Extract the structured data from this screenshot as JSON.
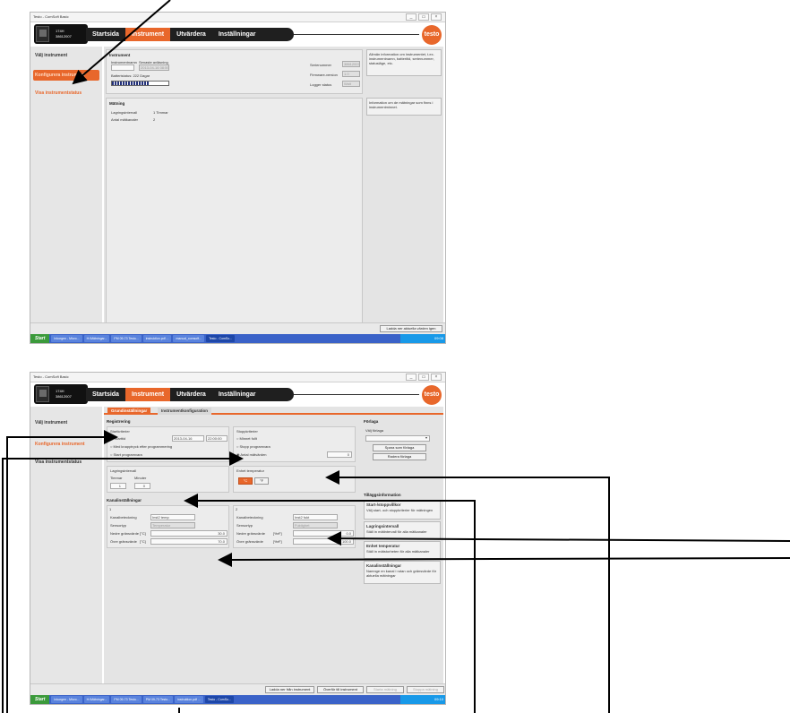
{
  "app_title": "Testo - ComSoft Basic",
  "window_controls": [
    "_",
    "▭",
    "×"
  ],
  "device": {
    "model": "174H",
    "serial": "38612007"
  },
  "nav_tabs": [
    "Startsida",
    "Instrument",
    "Utvärdera",
    "Inställningar"
  ],
  "logo_text": "testo",
  "shot1": {
    "sidebar": [
      "Välj instrument",
      "Konfigurera instrument",
      "Visa instrumentstatus"
    ],
    "instrument_panel": {
      "title": "Instrument",
      "name_label": "Instrumentnamn",
      "last_programming_label": "Senaste avläsning",
      "name_value": "",
      "last_programming_value": "2013-04-16 08:59:05",
      "battery_label": "Batteristatus: 222 Dagar",
      "battery_level_percent": 65,
      "serial_label": "Serienummer",
      "serial_value": "38612007",
      "firmware_label": "Firmware-version",
      "firmware_value": "1.0",
      "logger_label": "Logger status",
      "logger_value": "Wait"
    },
    "measurement_panel": {
      "title": "Mätning",
      "interval_label": "Lagringsintervall",
      "interval_value": "1 Timmar",
      "channels_label": "Antal mätkanaler",
      "channels_value": "2"
    },
    "tip1": "Allmän information om instrumentet, t.ex. instrumentnamn, batteritid, serienummer, statusläge, etc.",
    "tip2": "Information om de mätningar som finns i instrumentminnet.",
    "reload_button": "Ladda ner aktuella värden igen"
  },
  "shot2": {
    "sidebar": [
      "Välj instrument",
      "Konfigurera instrument",
      "Visa instrumentstatus"
    ],
    "subtabs": [
      "Grundinställningar",
      "Instrumentkonfiguration"
    ],
    "registration": {
      "title": "Registrering",
      "start_criteria": "Startkriterier",
      "start_options": [
        "Starttid",
        "Med knapptryck efter programmering",
        "Start programvara"
      ],
      "start_date": "2013-04-16",
      "start_time": "22:00:00",
      "stop_criteria": "Stoppkriterier",
      "stop_options": [
        "Minnet fullt",
        "Stopp programvara",
        "Antal mätvärden"
      ],
      "stop_count": "0"
    },
    "interval": {
      "title": "Lagringsintervall",
      "hours_label": "Timmar",
      "minutes_label": "Minuter",
      "hours": "1",
      "minutes": "0"
    },
    "unit": {
      "title": "Enhet temperatur",
      "c": "°C",
      "f": "°F"
    },
    "channels": {
      "title": "Kanalinställningar",
      "ch1": {
        "num": "1",
        "name_label": "Kanalbeteckning",
        "name": "Inst2 temp",
        "sensor_label": "Sensortyp",
        "sensor": "Temperatur",
        "lower_label": "Nedre gränsvärde",
        "lower_unit": "[°C]",
        "lower": "30.0",
        "upper_label": "Övre gränsvärde",
        "upper_unit": "[°C]",
        "upper": "70.0"
      },
      "ch2": {
        "num": "2",
        "name_label": "Kanalbeteckning",
        "name": "Inst2 fukt",
        "sensor_label": "Sensortyp",
        "sensor": "Fuktighet",
        "lower_label": "Nedre gränsvärde",
        "lower_unit": "[%rF]",
        "lower": "0.0",
        "upper_label": "Övre gränsvärde",
        "upper_unit": "[%rF]",
        "upper": "100.0"
      }
    },
    "template": {
      "title": "Förlaga",
      "choose": "Välj förlaga",
      "save": "Spara som förlaga",
      "delete": "Radera förlaga"
    },
    "extra_info": {
      "title": "Tilläggsinformation",
      "items": [
        {
          "head": "Start-/stoppvillkor",
          "body": "Välj start- och stoppkriterier för mätningen"
        },
        {
          "head": "Lagringsintervall",
          "body": "Ställ in mätintervall för alla mätkanaler"
        },
        {
          "head": "Enhet temperatur",
          "body": "Ställ in mätstorheten för alla mätkanaler"
        },
        {
          "head": "Kanalinställningar",
          "body": "Namnge en kanal i rutan och gränsvärde för aktuella mätningar"
        }
      ]
    },
    "buttons": [
      "Ladda ner från instrument",
      "Överför till instrument",
      "Starta mätning",
      "Stoppa mätning"
    ]
  },
  "taskbar": {
    "start": "Start",
    "items": [
      "Inkorgen - Micro...",
      "H:\\Mätningar...",
      "PM 09-73 Testo...",
      "PM 09-73 Testo...",
      "instruktion.pdf ...",
      "manual_comsoft...",
      "Testo - ComSo..."
    ],
    "clock1": "09:08",
    "clock2": "09:10"
  }
}
